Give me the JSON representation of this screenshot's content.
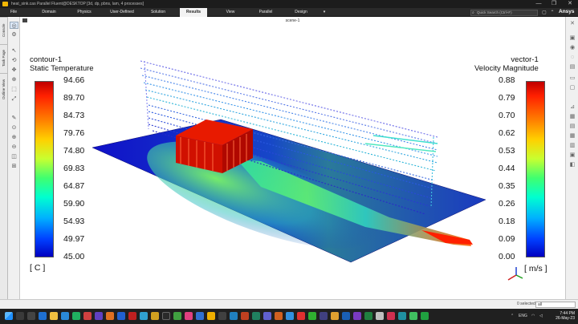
{
  "window": {
    "title": "heat_sink.cas Parallel Fluent@DESKTOP [3d, dp, pbns, lam, 4 processes]",
    "minimize": "—",
    "restore": "❐",
    "close": "✕"
  },
  "ribbon": {
    "menus": [
      {
        "label": "File",
        "active": false
      },
      {
        "label": "Domain",
        "active": false
      },
      {
        "label": "Physics",
        "active": false
      },
      {
        "label": "User-Defined",
        "active": false
      },
      {
        "label": "Solution",
        "active": false
      },
      {
        "label": "Results",
        "active": true
      },
      {
        "label": "View",
        "active": false
      },
      {
        "label": "Parallel",
        "active": false
      },
      {
        "label": "Design",
        "active": false
      }
    ],
    "search_placeholder": "Quick Search (Ctrl+F)",
    "brand": "Ansys"
  },
  "side_tabs": [
    "Outline View",
    "Task Page",
    "Console"
  ],
  "graphics": {
    "scene_title": "scene-1",
    "temperature_legend": {
      "title_line1": "contour-1",
      "title_line2": "Static Temperature",
      "ticks": [
        "94.66",
        "89.70",
        "84.73",
        "79.76",
        "74.80",
        "69.83",
        "64.87",
        "59.90",
        "54.93",
        "49.97",
        "45.00"
      ],
      "unit": "[ C ]"
    },
    "velocity_legend": {
      "title_line1": "vector-1",
      "title_line2": "Velocity Magnitude",
      "ticks": [
        "0.88",
        "0.79",
        "0.70",
        "0.62",
        "0.53",
        "0.44",
        "0.35",
        "0.26",
        "0.18",
        "0.09",
        "0.00"
      ],
      "unit": "[ m/s ]"
    }
  },
  "statusbar": {
    "selected_text": "0 selected",
    "selection_filter": "all"
  },
  "taskbar": {
    "language": "ENG",
    "time": "7:44 PM",
    "date": "26-May-23"
  }
}
